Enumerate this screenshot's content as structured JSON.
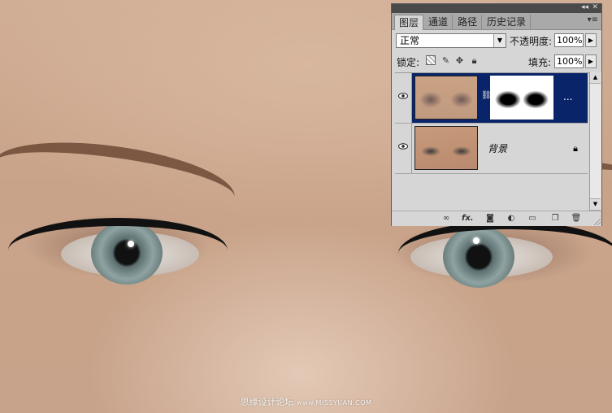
{
  "panel": {
    "tabs": [
      "图层",
      "通道",
      "路径",
      "历史记录"
    ],
    "active_tab": 0,
    "menu_icon": "panel-menu-icon",
    "collapse_icon": "double-arrow-icon",
    "close_icon": "close-icon",
    "blend_mode": "正常",
    "opacity_label": "不透明度:",
    "opacity_value": "100%",
    "lock_label": "锁定:",
    "lock_icons": [
      "lock-transparent-icon",
      "lock-image-icon",
      "lock-position-icon",
      "lock-all-icon"
    ],
    "fill_label": "填充:",
    "fill_value": "100%",
    "layers": [
      {
        "name": "...",
        "selected": true,
        "visible": true,
        "has_mask": true,
        "locked": false
      },
      {
        "name": "背景",
        "selected": false,
        "visible": true,
        "has_mask": false,
        "locked": true
      }
    ],
    "footer_icons": [
      "link-layers-icon",
      "fx-icon",
      "mask-icon",
      "adjustment-icon",
      "folder-icon",
      "new-layer-icon",
      "trash-icon"
    ],
    "fx_label": "fx."
  },
  "colors": {
    "selected_layer": "#0a246a",
    "panel_bg": "#d6d6d6",
    "skin": "#c9a389"
  },
  "watermark": {
    "text": "思缘设计论坛",
    "url": "www.MISSYUAN.COM"
  }
}
